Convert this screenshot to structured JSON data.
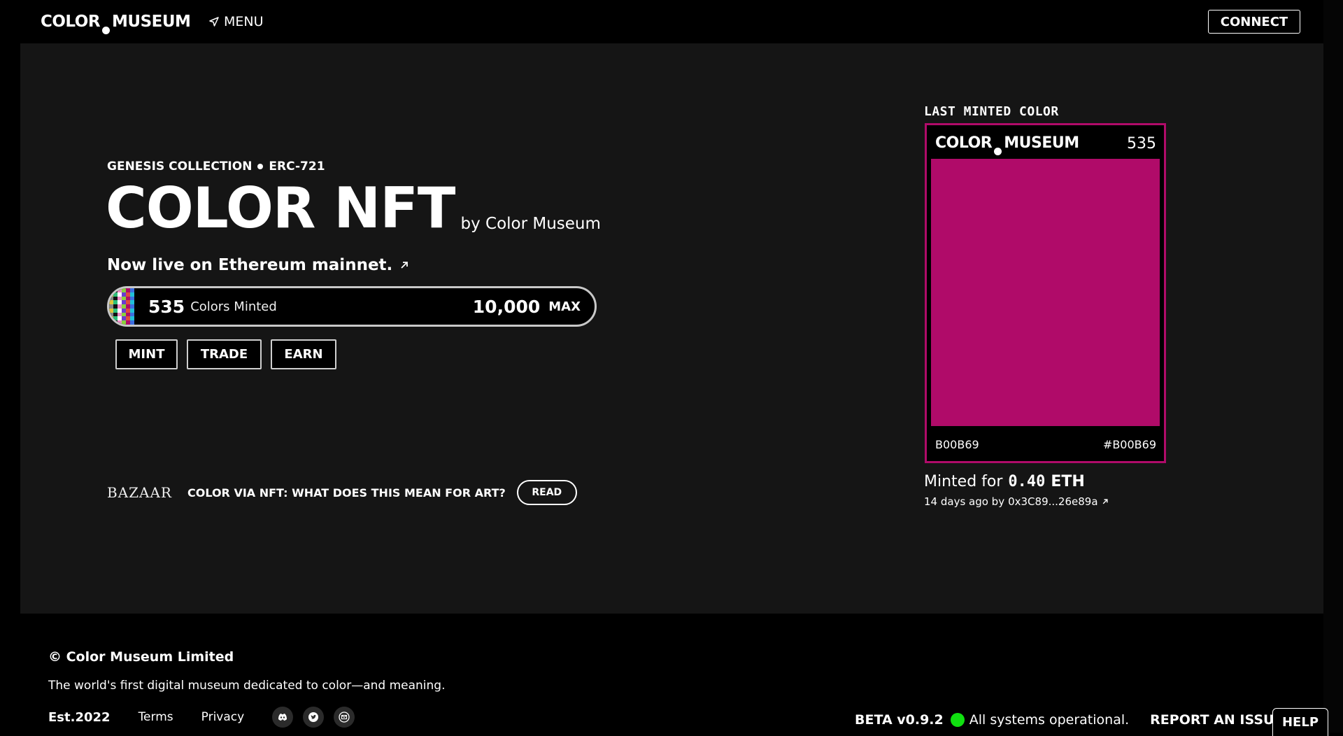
{
  "header": {
    "logo_left": "COLOR",
    "logo_right": "MUSEUM",
    "menu_label": "MENU",
    "connect_label": "CONNECT"
  },
  "hero": {
    "eyebrow_collection": "GENESIS COLLECTION",
    "eyebrow_standard": "ERC-721",
    "title": "COLOR NFT",
    "byline": "by Color Museum",
    "live_text": "Now live on Ethereum mainnet.",
    "minted_count": "535",
    "minted_label": "Colors Minted",
    "max_count": "10,000",
    "max_label": "MAX",
    "progress_fraction": 0.0535,
    "actions": [
      {
        "label": "MINT"
      },
      {
        "label": "TRADE"
      },
      {
        "label": "EARN"
      }
    ]
  },
  "press": {
    "source": "BAZAAR",
    "headline": "COLOR VIA NFT: WHAT DOES THIS MEAN FOR ART?",
    "read_label": "READ"
  },
  "last_minted": {
    "section_label": "LAST MINTED COLOR",
    "card_logo_left": "COLOR",
    "card_logo_right": "MUSEUM",
    "token_number": "535",
    "color_name": "B00B69",
    "color_hex": "#B00B69",
    "swatch_color": "#B00B69",
    "minted_for_label": "Minted for",
    "price": "0.40",
    "price_unit": "ETH",
    "when": "14 days ago by",
    "minter": "0x3C89...26e89a"
  },
  "footer": {
    "copyright": "© Color Museum Limited",
    "tagline": "The world's first digital museum dedicated to color—and meaning.",
    "est": "Est.2022",
    "terms": "Terms",
    "privacy": "Privacy",
    "social_icons": [
      "discord-icon",
      "twitter-icon",
      "mail-icon"
    ],
    "version": "BETA v0.9.2",
    "status_text": "All systems operational.",
    "report_label": "REPORT AN ISSUE",
    "help_label": "HELP",
    "status_color": "#10E010"
  },
  "colors": {
    "accent": "#B00B69",
    "panel_bg": "#151515",
    "page_bg": "#000000"
  }
}
